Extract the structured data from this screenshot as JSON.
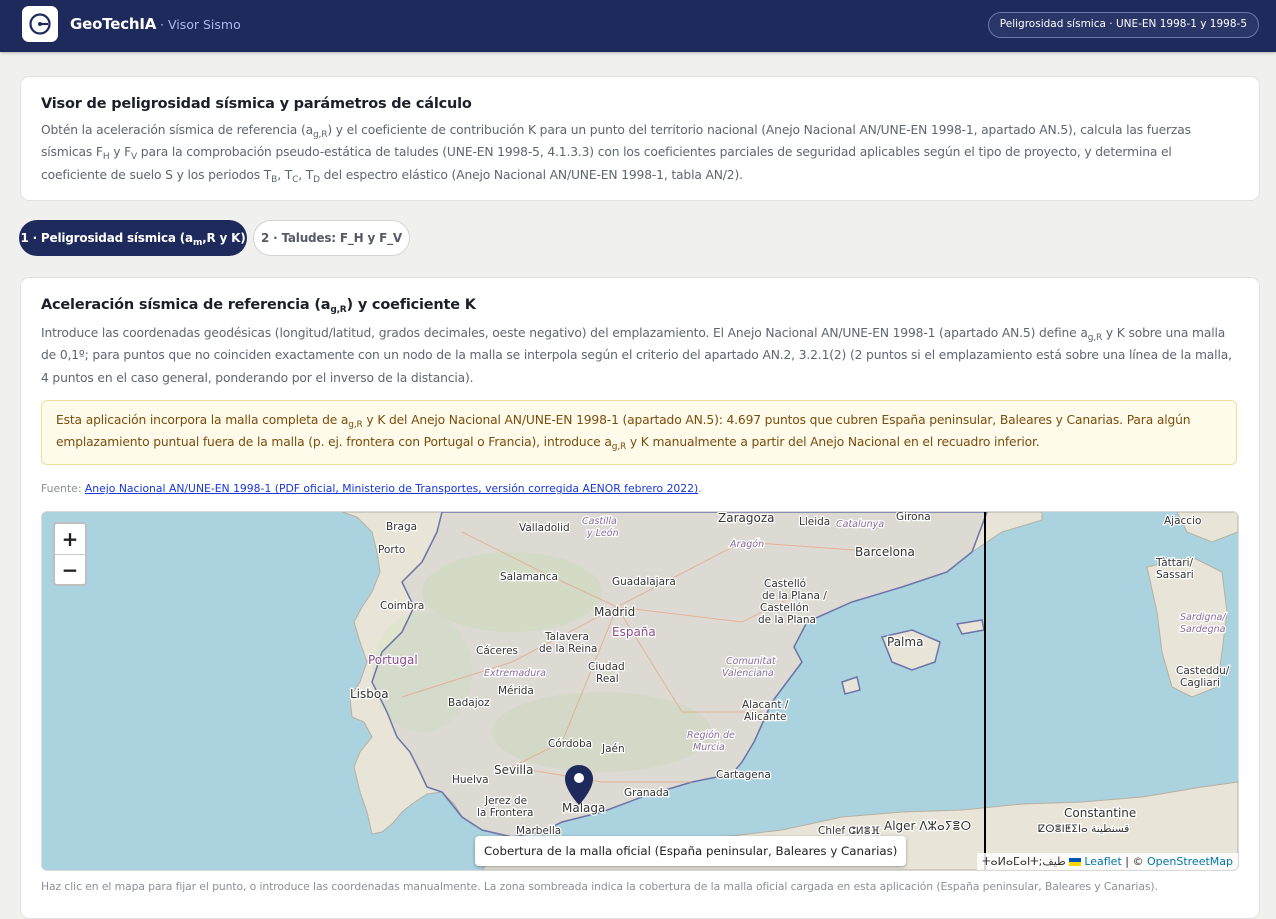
{
  "header": {
    "brand": "GeoTechIA",
    "subtitle": "· Visor Sismo",
    "badge": "Peligrosidad sísmica · UNE-EN 1998-1 y 1998-5"
  },
  "intro": {
    "title": "Visor de peligrosidad sísmica y parámetros de cálculo",
    "p1": "Obtén la aceleración sísmica de referencia (a",
    "p1_sub": "g,R",
    "p2": ") y el coeficiente de contribución K para un punto del territorio nacional (Anejo Nacional AN/UNE-EN 1998-1, apartado AN.5), calcula las fuerzas sísmicas F",
    "p2_sub": "H",
    "p3": " y F",
    "p3_sub": "V",
    "p4": " para la comprobación pseudo-estática de taludes (UNE-EN 1998-5, 4.1.3.3) con los coeficientes parciales de seguridad aplicables según el tipo de proyecto, y determina el coeficiente de suelo S y los periodos T",
    "p4_sub": "B",
    "p5": ", T",
    "p5_sub": "C",
    "p6": ", T",
    "p6_sub": "D",
    "p7": " del espectro elástico (Anejo Nacional AN/UNE-EN 1998-1, tabla AN/2)."
  },
  "tabs": {
    "tab1_pre": "1 · Peligrosidad sísmica (a",
    "tab1_sub": "m",
    "tab1_post": ",R y K)",
    "tab2": "2 · Taludes: F_H y F_V"
  },
  "section": {
    "title_pre": "Aceleración sísmica de referencia (a",
    "title_sub": "g,R",
    "title_post": ") y coeficiente K",
    "d1": "Introduce las coordenadas geodésicas (longitud/latitud, grados decimales, oeste negativo) del emplazamiento. El Anejo Nacional AN/UNE-EN 1998-1 (apartado AN.5) define a",
    "d1_sub": "g,R",
    "d2": " y K sobre una malla de 0,1º; para puntos que no coinciden exactamente con un nodo de la malla se interpola según el criterio del apartado AN.2, 3.2.1(2) (2 puntos si el emplazamiento está sobre una línea de la malla, 4 puntos en el caso general, ponderando por el inverso de la distancia).",
    "notice_1": "Esta aplicación incorpora la malla completa de a",
    "notice_1_sub": "g,R",
    "notice_2": " y K del Anejo Nacional AN/UNE-EN 1998-1 (apartado AN.5): 4.697 puntos que cubren España peninsular, Baleares y Canarias. Para algún emplazamiento puntual fuera de la malla (p. ej. frontera con Portugal o Francia), introduce a",
    "notice_2_sub": "g,R",
    "notice_3": " y K manualmente a partir del Anejo Nacional en el recuadro inferior.",
    "source_label": "Fuente:",
    "source_link": "Anejo Nacional AN/UNE-EN 1998-1 (PDF oficial, Ministerio de Transportes, versión corregida AENOR febrero 2022)",
    "source_end": ".",
    "hint": "Haz clic en el mapa para fijar el punto, o introduce las coordenadas manualmente. La zona sombreada indica la cobertura de la malla oficial cargada en esta aplicación (España peninsular, Baleares y Canarias)."
  },
  "map": {
    "zoom_in": "+",
    "zoom_out": "−",
    "tooltip": "Cobertura de la malla oficial (España peninsular, Baleares y Canarias)",
    "attrib_leaflet": "Leaflet",
    "attrib_sep": " | © ",
    "attrib_osm": "OpenStreetMap",
    "attrib_pre": "ⵜⴰⵍⴰⵎⴰⵏⵜ;طيف",
    "labels": {
      "braga": "Braga",
      "valladolid": "Valladolid",
      "castilla1": "Castilla",
      "castilla2": "y León",
      "zaragoza": "Zaragoza",
      "lleida": "Lleida",
      "catalunya": "Catalunya",
      "girona": "Girona",
      "aragon": "Aragón",
      "barcelona": "Barcelona",
      "porto": "Porto",
      "salamanca": "Salamanca",
      "guadalajara": "Guadalajara",
      "castello1": "Castelló",
      "castello2": "de la Plana /",
      "castello3": "Castellón",
      "castello4": "de la Plana",
      "coimbra": "Coimbra",
      "madrid": "Madrid",
      "espana": "España",
      "talavera1": "Talavera",
      "talavera2": "de la Reina",
      "palma": "Palma",
      "portugal": "Portugal",
      "caceres": "Cáceres",
      "ciudad1": "Ciudad",
      "ciudad2": "Real",
      "comunitat1": "Comunitat",
      "comunitat2": "Valenciana",
      "extremadura": "Extremadura",
      "merida": "Mérida",
      "lisboa": "Lisboa",
      "badajoz": "Badajoz",
      "alacant1": "Alacant /",
      "alacant2": "Alicante",
      "region1": "Región de",
      "region2": "Murcia",
      "cordoba": "Córdoba",
      "jaen": "Jaén",
      "sevilla": "Sevilla",
      "huelva": "Huelva",
      "cartagena": "Cartagena",
      "jerez1": "Jerez de",
      "jerez2": "la Frontera",
      "malaga": "Malaga",
      "granada": "Granada",
      "marbella": "Marbella",
      "chlef": "Chlef ⵛⵍⴻⴼ",
      "alger": "Alger ⴷⵣⴰⵢⴻⵔ",
      "constantine": "Constantine",
      "qsantina": "ⵇⵙⴻⵏⵟⵉⵏⴰ قسنطينة",
      "ajaccio": "Ajaccio",
      "tattari1": "Tàttari/",
      "tattari2": "Sassari",
      "sardigna1": "Sardigna/",
      "sardigna2": "Sardegna",
      "casteddu1": "Casteddu/",
      "casteddu2": "Cagliari"
    }
  },
  "colors": {
    "header_bg": "#1f2a5c",
    "accent": "#1f2a5c",
    "notice_bg": "#fefbea",
    "notice_text": "#7b4d0d",
    "link": "#1a36d6",
    "sea": "#aad3df",
    "land": "#e8e4d8",
    "marker": "#1f2a5c"
  }
}
